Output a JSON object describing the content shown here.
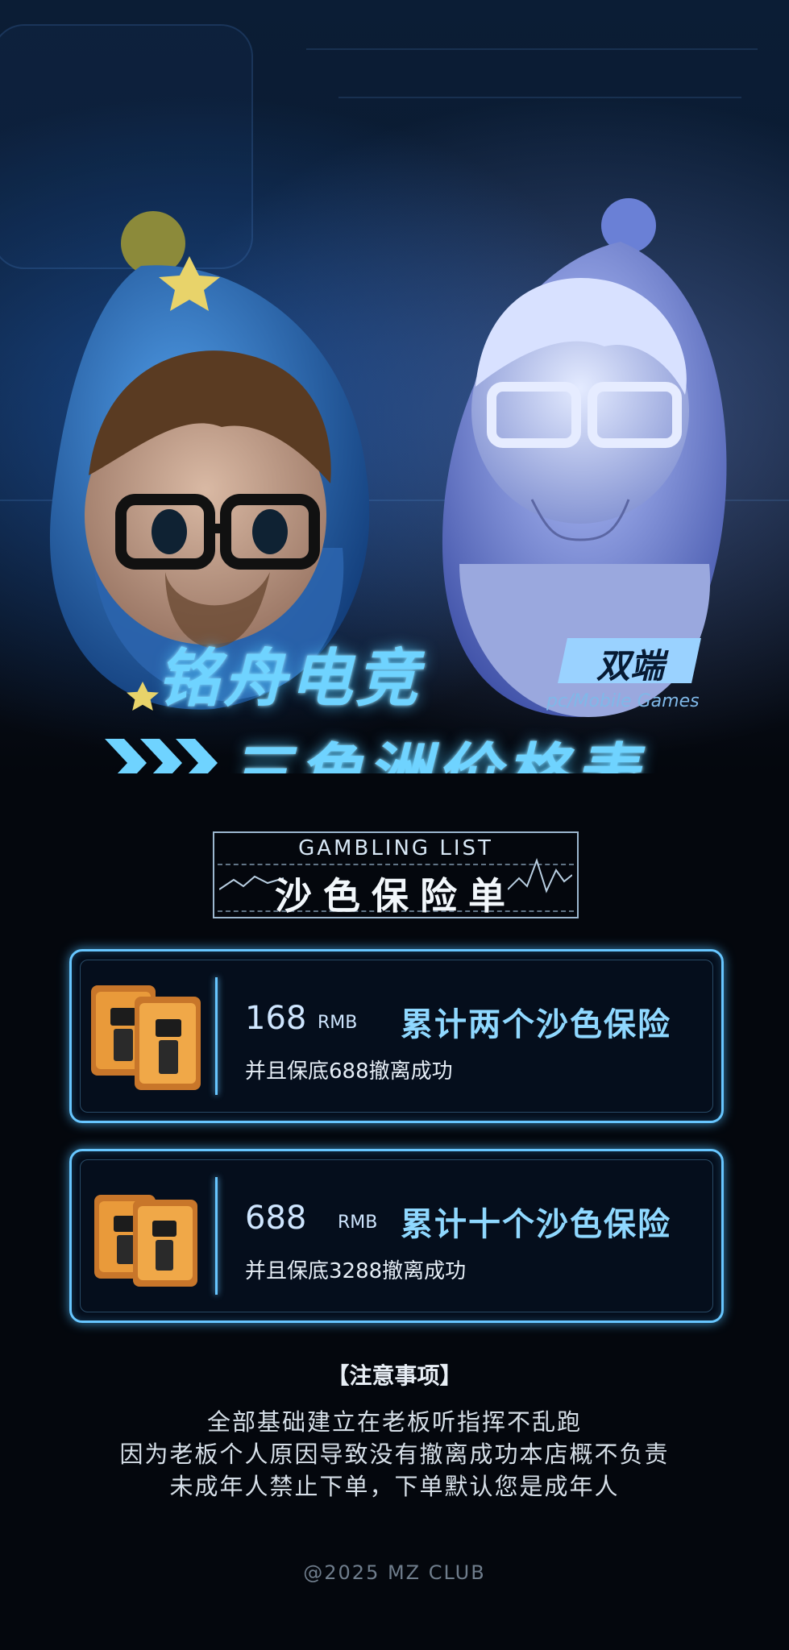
{
  "hero": {
    "brand": "铭舟电竞",
    "badge": "双端",
    "platforms": "pc/Mobile Games",
    "subtitle": "三角洲价格表"
  },
  "list_header": {
    "en": "GAMBLING LIST",
    "cn": "沙色保险单"
  },
  "packages": [
    {
      "price": "168",
      "currency": "RMB",
      "offer": "累计两个沙色保险",
      "guarantee": "并且保底688撤离成功"
    },
    {
      "price": "688",
      "currency": "RMB",
      "offer": "累计十个沙色保险",
      "guarantee": "并且保底3288撤离成功"
    }
  ],
  "notice": {
    "title": "【注意事项】",
    "lines": [
      "全部基础建立在老板听指挥不乱跑",
      "因为老板个人原因导致没有撤离成功本店概不负责",
      "未成年人禁止下单，下单默认您是成年人"
    ]
  },
  "footer": "@2025 MZ CLUB",
  "colors": {
    "neon": "#6fd3ff",
    "card_border": "#67c6ff",
    "background": "#04070d",
    "safe_orange": "#e99a3a"
  }
}
